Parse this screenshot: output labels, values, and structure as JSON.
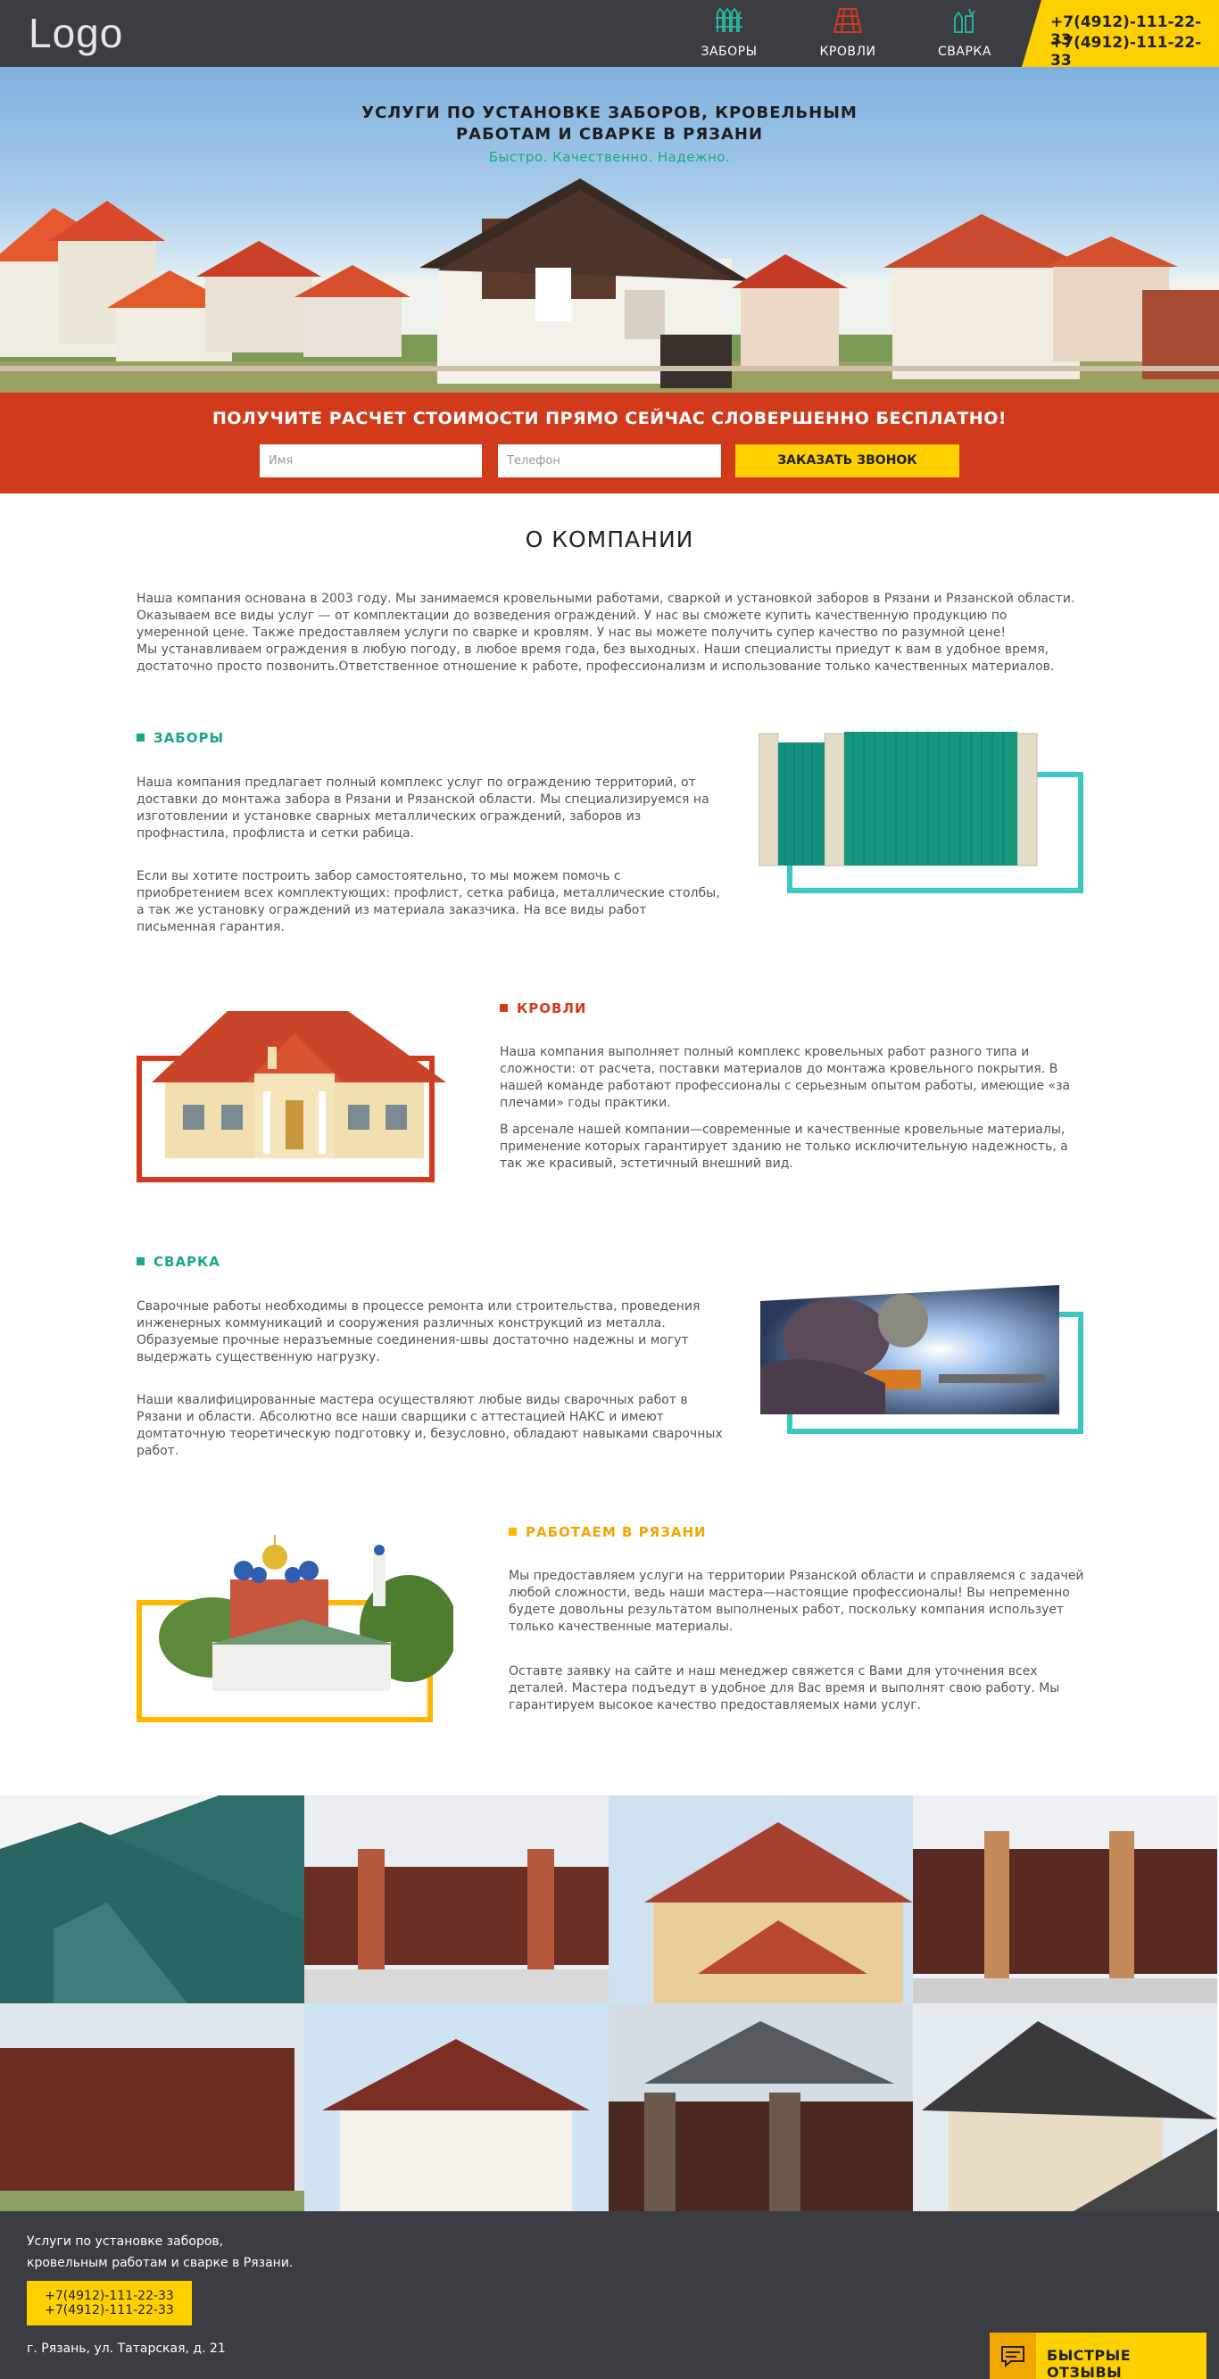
{
  "header": {
    "logo": "Logo",
    "nav": [
      {
        "label": "ЗАБОРЫ",
        "icon": "fence-icon"
      },
      {
        "label": "КРОВЛИ",
        "icon": "roof-icon"
      },
      {
        "label": "СВАРКА",
        "icon": "welding-icon"
      }
    ],
    "phones": [
      "+7(4912)-111-22-33",
      "+7(4912)-111-22-33"
    ]
  },
  "hero": {
    "title_line1": "УСЛУГИ ПО УСТАНОВКЕ ЗАБОРОВ, КРОВЕЛЬНЫМ",
    "title_line2": "РАБОТАМ И СВАРКЕ В РЯЗАНИ",
    "subtitle": "Быстро. Качественно. Надежно."
  },
  "order": {
    "title": "ПОЛУЧИТЕ РАСЧЕТ СТОИМОСТИ ПРЯМО СЕЙЧАС СЛОВЕРШЕННО БЕСПЛАТНО!",
    "name_placeholder": "Имя",
    "phone_placeholder": "Телефон",
    "button": "ЗАКАЗАТЬ ЗВОНОК"
  },
  "about": {
    "title": "О КОМПАНИИ",
    "text": "Наша компания основана в 2003 году. Мы занимаемся кровельными работами, сваркой и установкой заборов в Рязани и Рязанской области. Оказываем все виды услуг — от комплектации до возведения ограждений. У нас вы сможете купить качественную продукцию по умеренной цене. Также предоставляем услуги по сварке и кровлям. У нас вы можете получить супер качество по разумной цене!",
    "text2": "Мы устанавливаем ограждения в любую погоду, в любое время года, без выходных. Наши специалисты приедут к вам в удобное время, достаточно просто позвонить.Ответственное отношение к работе, профессионализм и использование только качественных материалов."
  },
  "sections": {
    "fences": {
      "title": "ЗАБОРЫ",
      "p1": "Наша компания предлагает полный комплекс услуг по ограждению территорий, от доставки до монтажа забора в Рязани и Рязанской области. Мы специализируемся на изготовлении и установке сварных металлических ограждений, заборов из профнастила, профлиста и сетки рабица.",
      "p2": "Если вы хотите построить забор самостоятельно, то мы можем помочь с приобретением всех комплектующих: профлист, сетка рабица, металлические столбы, а так же установку ограждений из материала заказчика. На все виды работ письменная гарантия."
    },
    "roofs": {
      "title": "КРОВЛИ",
      "p1": "Наша компания выполняет полный комплекс кровельных работ разного типа и сложности: от расчета, поставки материалов до монтажа кровельного покрытия. В нашей команде работают профессионалы с серьезным опытом работы, имеющие «за плечами» годы практики.",
      "p2": "В арсенале нашей компании—современные и качественные кровельные материалы, применение которых гарантирует зданию не только исключительную надежность, а так же красивый, эстетичный внешний вид."
    },
    "welding": {
      "title": "СВАРКА",
      "p1": "Сварочные работы необходимы в процессе ремонта или строительства, проведения инженерных коммуникаций и сооружения различных конструкций из металла. Образуемые прочные неразъемные соединения-швы достаточно надежны и могут выдержать существенную нагрузку.",
      "p2": "Наши квалифицированные мастера осуществляют любые виды сварочных работ в Рязани и области. Абсолютно все наши сварщики с аттестацией НАКС и имеют домтаточную теоретическую подготовку и, безусловно, обладают навыками сварочных работ."
    },
    "ryazan": {
      "title": "РАБОТАЕМ В РЯЗАНИ",
      "p1": "Мы предоставляем услуги на территории Рязанской области и справляемся с задачей любой сложности, ведь наши мастера—настоящие профессионалы! Вы непременно будете довольны результатом выполненых работ, поскольку компания использует только качественные материалы.",
      "p2": "Оставте заявку на сайте и наш менеджер свяжется с Вами для уточнения всех деталей. Мастера подъедут в удобное для Вас время и выполнят свою работу. Мы гарантируем высокое качество предоставляемых нами услуг."
    }
  },
  "colors": {
    "dark": "#3b3d42",
    "yellow": "#ffd000",
    "red": "#d23a1c",
    "teal": "#1aa888",
    "turquoise": "#3cc8c0"
  },
  "footer": {
    "tagline1": "Услуги по установке заборов,",
    "tagline2": "кровельным работам и сварке в Рязани.",
    "phones": [
      "+7(4912)-111-22-33",
      "+7(4912)-111-22-33"
    ],
    "address": "г. Рязань, ул. Татарская, д. 21",
    "reviews_button": "БЫСТРЫЕ ОТЗЫВЫ"
  }
}
